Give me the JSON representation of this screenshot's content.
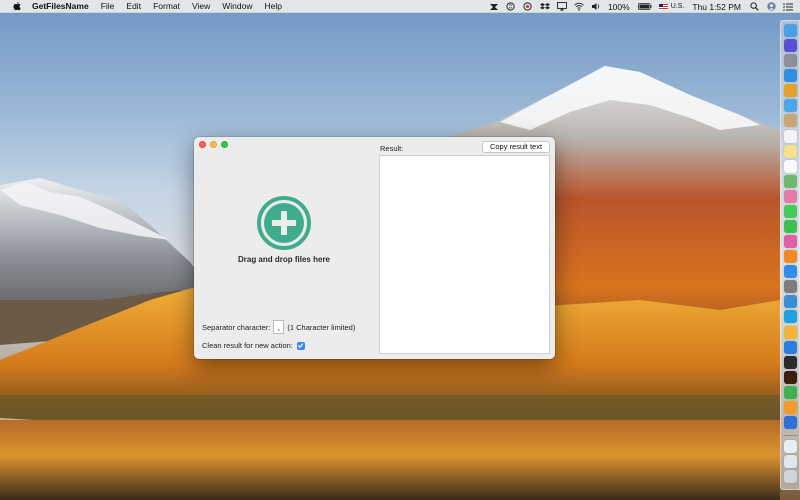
{
  "menubar": {
    "app_name": "GetFilesName",
    "menus": [
      "File",
      "Edit",
      "Format",
      "View",
      "Window",
      "Help"
    ],
    "battery": "100%",
    "input_source": "U.S.",
    "clock": "Thu 1:52 PM",
    "status_icons": [
      "snippets-icon",
      "skype-icon",
      "screen-recorder-icon",
      "dropbox-icon",
      "airplay-icon",
      "wifi-icon",
      "volume-icon",
      "battery-icon"
    ]
  },
  "window": {
    "drop_label": "Drag and drop files here",
    "separator_label": "Separator character:",
    "separator_value": ",",
    "separator_hint": "(1 Character limited)",
    "clean_label": "Clean result for new action:",
    "clean_checked": true,
    "result_label": "Result:",
    "copy_button": "Copy result text",
    "result_text": "",
    "accent_color": "#3fac8c",
    "checkbox_color": "#3b87f7"
  },
  "dock": {
    "apps": [
      {
        "name": "finder-icon",
        "color": "#4a9fe6"
      },
      {
        "name": "siri-icon",
        "color": "#5b4fd6"
      },
      {
        "name": "launchpad-icon",
        "color": "#8a8f99"
      },
      {
        "name": "safari-icon",
        "color": "#2f8de4"
      },
      {
        "name": "chrome-icon",
        "color": "#e4a22a"
      },
      {
        "name": "mail-icon",
        "color": "#4aa6e8"
      },
      {
        "name": "contacts-icon",
        "color": "#c9a57a"
      },
      {
        "name": "calendar-icon",
        "color": "#f3f3f3"
      },
      {
        "name": "notes-icon",
        "color": "#f7e08b"
      },
      {
        "name": "reminders-icon",
        "color": "#fafafa"
      },
      {
        "name": "maps-icon",
        "color": "#6db86a"
      },
      {
        "name": "photos-icon",
        "color": "#e67aa9"
      },
      {
        "name": "messages-icon",
        "color": "#47c957"
      },
      {
        "name": "facetime-icon",
        "color": "#3fbf4d"
      },
      {
        "name": "itunes-icon",
        "color": "#e05fa3"
      },
      {
        "name": "ibooks-icon",
        "color": "#f08a24"
      },
      {
        "name": "app-store-icon",
        "color": "#2e8fe8"
      },
      {
        "name": "system-preferences-icon",
        "color": "#7d7d7d"
      },
      {
        "name": "xcode-icon",
        "color": "#3b8ed6"
      },
      {
        "name": "skype-app-icon",
        "color": "#1ea0e2"
      },
      {
        "name": "sketch-icon",
        "color": "#f2b536"
      },
      {
        "name": "pin-app-icon",
        "color": "#2a7de1"
      },
      {
        "name": "terminal-icon",
        "color": "#2b2b2b"
      },
      {
        "name": "illustrator-icon",
        "color": "#3a1f10"
      },
      {
        "name": "numbers-icon",
        "color": "#3fb04f"
      },
      {
        "name": "pages-icon",
        "color": "#f39a28"
      },
      {
        "name": "keynote-icon",
        "color": "#2f6fd8"
      }
    ],
    "stack_items": [
      {
        "name": "downloads-stack-icon",
        "color": "#e9eef3"
      },
      {
        "name": "documents-stack-icon",
        "color": "#dfe6ee"
      },
      {
        "name": "trash-icon",
        "color": "#cfd5db"
      }
    ]
  }
}
